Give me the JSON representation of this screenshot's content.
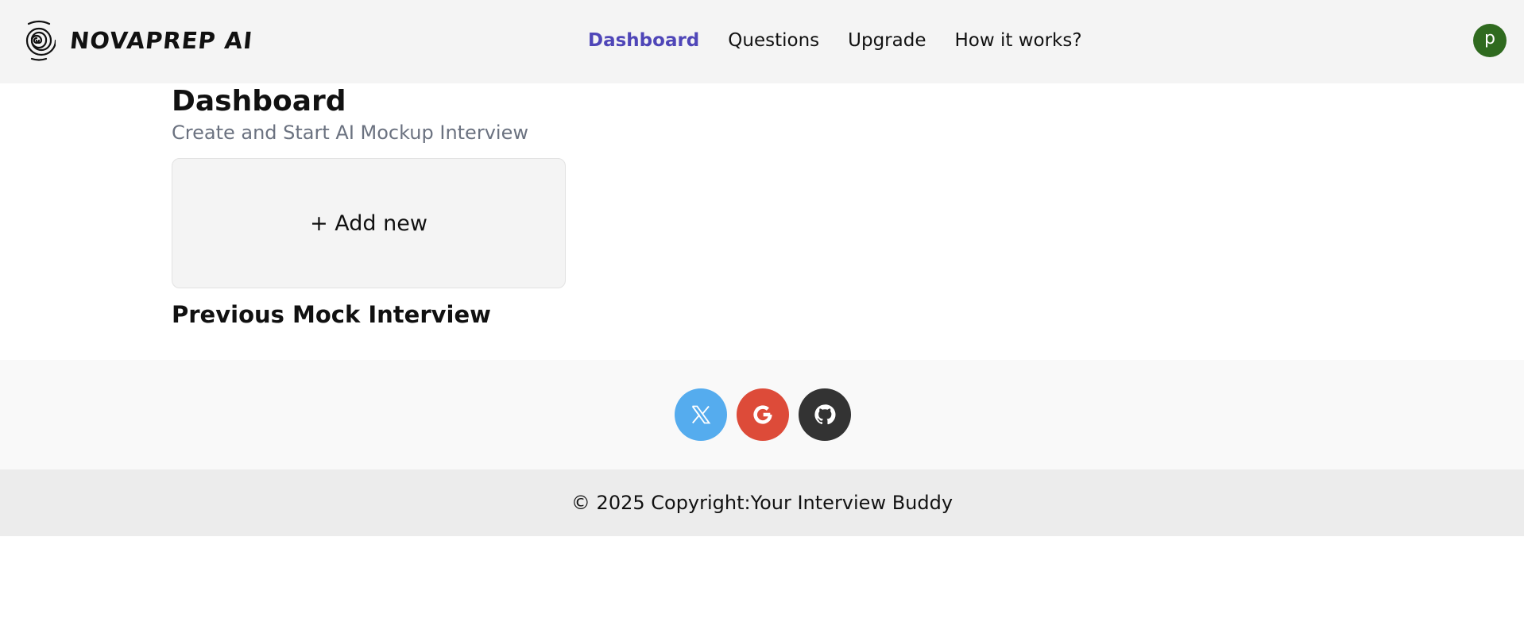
{
  "brand": {
    "name": "NOVAPREP AI",
    "logo_icon": "spiral-fingerprint-icon"
  },
  "nav": {
    "items": [
      {
        "label": "Dashboard",
        "active": true
      },
      {
        "label": "Questions",
        "active": false
      },
      {
        "label": "Upgrade",
        "active": false
      },
      {
        "label": "How it works?",
        "active": false
      }
    ]
  },
  "user": {
    "avatar_letter": "p",
    "avatar_color": "#2f6a1f"
  },
  "main": {
    "title": "Dashboard",
    "subtitle": "Create and Start AI Mockup Interview",
    "add_new_label": "+ Add new",
    "previous_section_title": "Previous Mock Interview"
  },
  "social": {
    "items": [
      {
        "icon": "x-twitter-icon",
        "color": "#55acee"
      },
      {
        "icon": "google-icon",
        "color": "#dd4b39"
      },
      {
        "icon": "github-icon",
        "color": "#333333"
      }
    ]
  },
  "footer": {
    "copyright": "© 2025 Copyright:Your Interview Buddy"
  },
  "colors": {
    "accent": "#4f46b8",
    "header_bg": "#f4f4f4",
    "subtitle": "#6b7280"
  }
}
